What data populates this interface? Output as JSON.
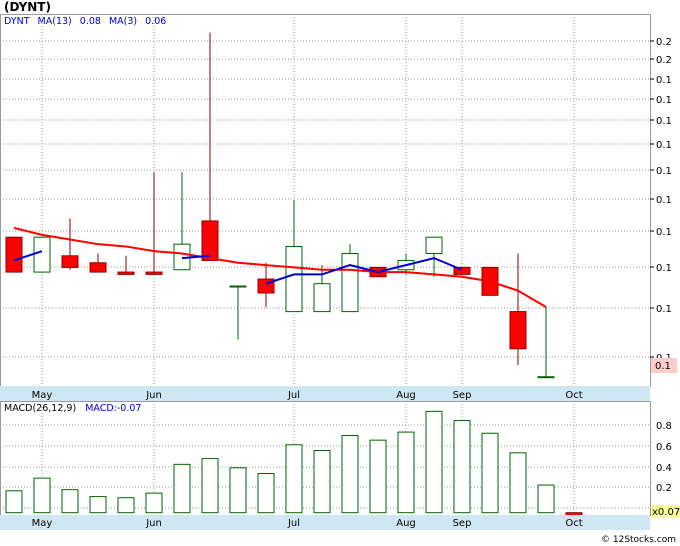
{
  "title": "(DYNT)",
  "credit": "© 12Stocks.com",
  "colors": {
    "up": "#006400",
    "down": "#ff0000",
    "ma13": "#ff0000",
    "ma3": "#0000cc",
    "macd_bar": "#006400",
    "macd_neg": "#ff0000",
    "axis_band": "#cfe7f3",
    "price_tag_bg": "#ffcccc",
    "macd_tag_bg": "#ffff99",
    "grid": "#999999"
  },
  "price_legend": {
    "symbol": "DYNT",
    "ma13_label": "MA(13)",
    "ma13_value": "0.08",
    "ma3_label": "MA(3)",
    "ma3_value": "0.06"
  },
  "macd_legend": {
    "label": "MACD(26,12,9)",
    "value_label": "MACD:-0.07"
  },
  "x_axis_labels": [
    "May",
    "Jun",
    "Jul",
    "Aug",
    "Sep",
    "Oct"
  ],
  "price_tick_labels": [
    "0.2",
    "0.2",
    "0.1",
    "0.1",
    "0.1",
    "0.1",
    "0.1",
    "0.1",
    "0.1",
    "0.1",
    "0.1",
    "0.1"
  ],
  "price_tag": "0.1",
  "macd_tick_labels": [
    "0.8",
    "0.6",
    "0.4",
    "0.2",
    "0.0"
  ],
  "macd_tag": "x0.07",
  "chart_data": [
    {
      "type": "candlestick",
      "title": "(DYNT)",
      "x_labels": [
        "May",
        "Jun",
        "Jul",
        "Aug",
        "Sep",
        "Oct"
      ],
      "series": [
        {
          "name": "DYNT",
          "ohlc": [
            {
              "open": 0.127,
              "high": 0.127,
              "low": 0.112,
              "close": 0.112
            },
            {
              "open": 0.112,
              "high": 0.127,
              "low": 0.112,
              "close": 0.127
            },
            {
              "open": 0.119,
              "high": 0.135,
              "low": 0.113,
              "close": 0.114
            },
            {
              "open": 0.116,
              "high": 0.12,
              "low": 0.112,
              "close": 0.112
            },
            {
              "open": 0.112,
              "high": 0.119,
              "low": 0.111,
              "close": 0.111
            },
            {
              "open": 0.112,
              "high": 0.155,
              "low": 0.111,
              "close": 0.111
            },
            {
              "open": 0.113,
              "high": 0.155,
              "low": 0.113,
              "close": 0.124
            },
            {
              "open": 0.134,
              "high": 0.215,
              "low": 0.117,
              "close": 0.117
            },
            {
              "open": 0.106,
              "high": 0.106,
              "low": 0.083,
              "close": 0.106
            },
            {
              "open": 0.109,
              "high": 0.116,
              "low": 0.097,
              "close": 0.103
            },
            {
              "open": 0.095,
              "high": 0.143,
              "low": 0.095,
              "close": 0.123
            },
            {
              "open": 0.095,
              "high": 0.115,
              "low": 0.095,
              "close": 0.107
            },
            {
              "open": 0.095,
              "high": 0.124,
              "low": 0.095,
              "close": 0.12
            },
            {
              "open": 0.114,
              "high": 0.114,
              "low": 0.11,
              "close": 0.11
            },
            {
              "open": 0.113,
              "high": 0.12,
              "low": 0.111,
              "close": 0.117
            },
            {
              "open": 0.12,
              "high": 0.127,
              "low": 0.11,
              "close": 0.127
            },
            {
              "open": 0.114,
              "high": 0.114,
              "low": 0.111,
              "close": 0.111
            },
            {
              "open": 0.114,
              "high": 0.114,
              "low": 0.102,
              "close": 0.102
            },
            {
              "open": 0.095,
              "high": 0.12,
              "low": 0.072,
              "close": 0.079
            },
            {
              "open": 0.067,
              "high": 0.097,
              "low": 0.067,
              "close": 0.067
            }
          ]
        },
        {
          "name": "MA(13)",
          "values": [
            0.131,
            0.128,
            0.126,
            0.124,
            0.123,
            0.121,
            0.12,
            0.118,
            0.116,
            0.115,
            0.114,
            0.113,
            0.113,
            0.112,
            0.112,
            0.111,
            0.11,
            0.108,
            0.104,
            0.097
          ]
        },
        {
          "name": "MA(3)",
          "values": [
            0.117,
            0.121,
            null,
            null,
            null,
            null,
            0.118,
            0.119,
            null,
            0.107,
            0.111,
            0.111,
            0.115,
            0.112,
            0.115,
            0.118,
            0.113,
            null,
            null,
            null
          ]
        }
      ],
      "ylim": [
        0.063,
        0.223
      ]
    },
    {
      "type": "bar",
      "title": "MACD(26,12,9)",
      "series": [
        {
          "name": "MACD",
          "values": [
            0.19,
            0.3,
            0.2,
            0.14,
            0.13,
            0.17,
            0.42,
            0.47,
            0.39,
            0.34,
            0.59,
            0.54,
            0.67,
            0.63,
            0.7,
            0.88,
            0.8,
            0.69,
            0.52,
            0.24,
            -0.07
          ]
        }
      ],
      "ylim": [
        -0.02,
        0.97
      ]
    }
  ]
}
